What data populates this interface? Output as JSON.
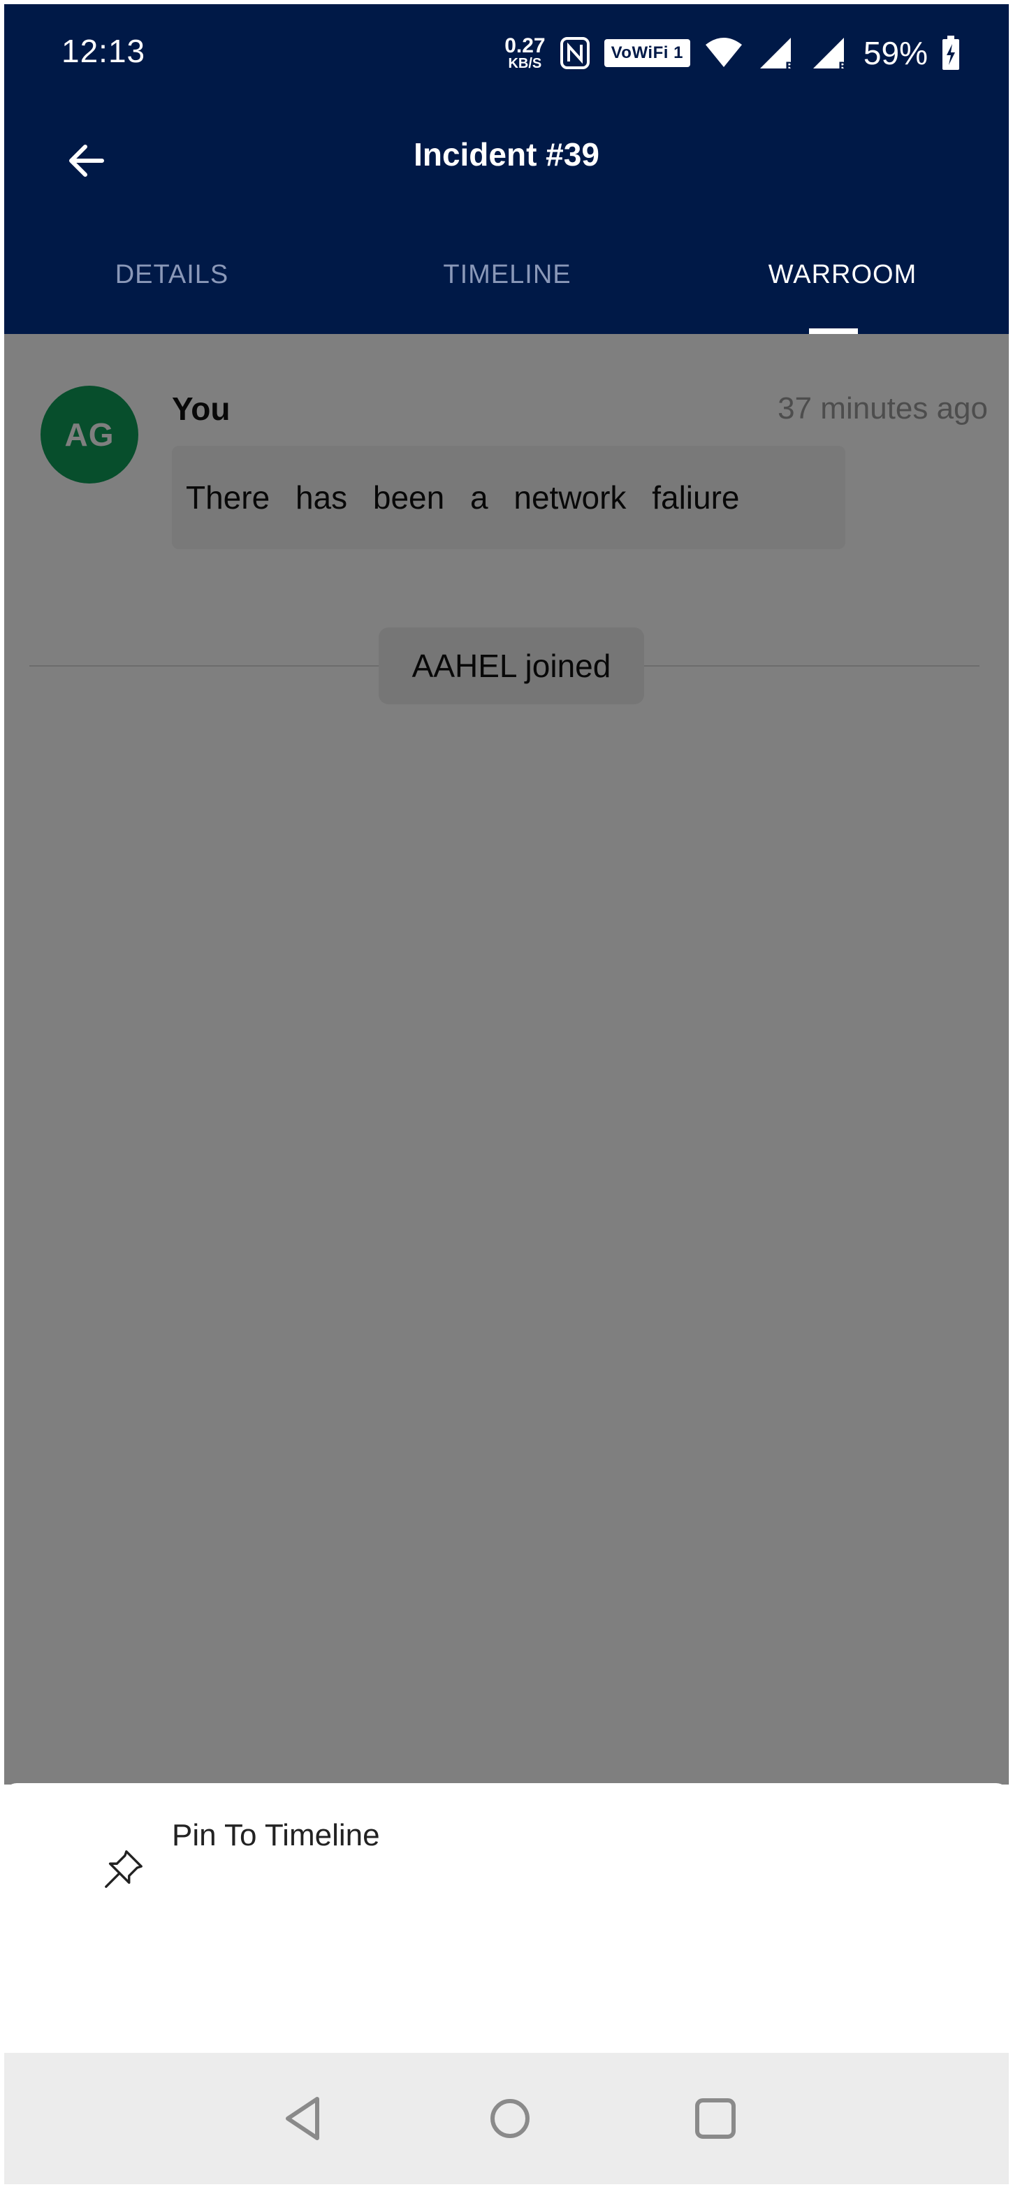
{
  "status_bar": {
    "time": "12:13",
    "net_speed_value": "0.27",
    "net_speed_unit": "KB/S",
    "wifi_badge": "VoWiFi 1",
    "battery_percent": "59%"
  },
  "app_bar": {
    "title": "Incident #39",
    "back_icon": "arrow-left-icon"
  },
  "tabs": [
    {
      "label": "DETAILS",
      "active": false
    },
    {
      "label": "TIMELINE",
      "active": false
    },
    {
      "label": "WARROOM",
      "active": true
    }
  ],
  "warroom": {
    "message": {
      "avatar_initials": "AG",
      "avatar_color": "#0f9d58",
      "author": "You",
      "time": "37 minutes ago",
      "text": "There has been a network faliure"
    },
    "system_event": "AAHEL joined"
  },
  "bottom_sheet": {
    "items": [
      {
        "icon": "pin-icon",
        "label": "Pin To Timeline"
      }
    ]
  },
  "nav_bar": {
    "icons": [
      "back-triangle-icon",
      "home-circle-icon",
      "recents-square-icon"
    ]
  },
  "colors": {
    "header_bg": "#001947",
    "accent": "#ffffff",
    "inactive_tab": "#8a98b8"
  }
}
